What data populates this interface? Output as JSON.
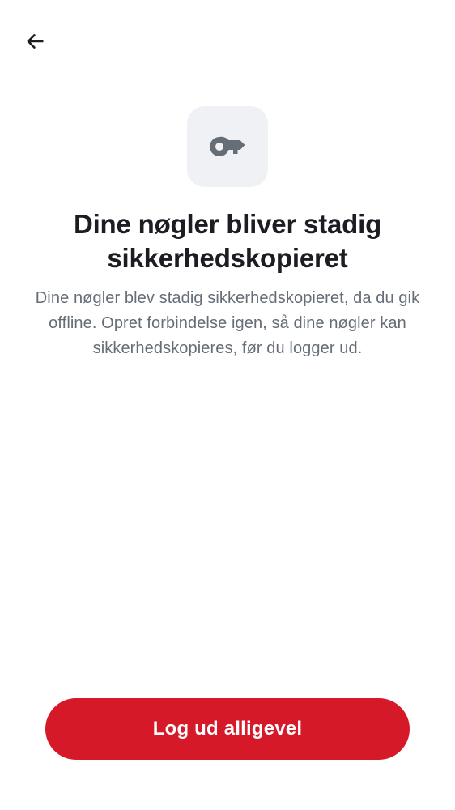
{
  "header": {
    "back_icon": "arrow-left-icon"
  },
  "hero": {
    "icon": "key-icon",
    "tile_color": "#f0f1f4",
    "icon_color": "#656d77"
  },
  "content": {
    "title": "Dine nøgler bliver stadig sikkerhedskopieret",
    "description": "Dine nøgler blev stadig sikkerhedskopieret, da du gik offline. Opret forbindelse igen, så dine nøgler kan sikkerhedskopieres, før du logger ud."
  },
  "actions": {
    "logout_label": "Log ud alligevel",
    "logout_color": "#d51928"
  }
}
